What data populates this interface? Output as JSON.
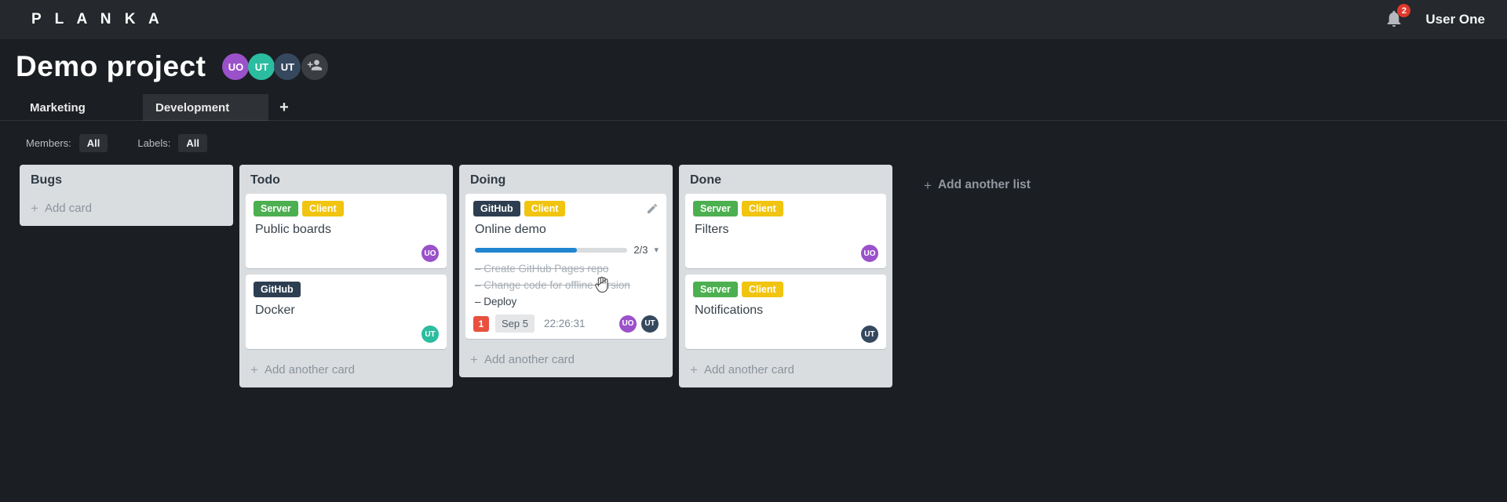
{
  "header": {
    "logo": "P L A N K A",
    "notifications_count": "2",
    "user_name": "User One"
  },
  "project": {
    "title": "Demo project",
    "members": [
      {
        "initials": "UO",
        "color": "#9b51c9"
      },
      {
        "initials": "UT",
        "color": "#2bbd9f"
      },
      {
        "initials": "UT",
        "color": "#35485e"
      }
    ]
  },
  "tabs": {
    "items": [
      {
        "label": "Marketing"
      },
      {
        "label": "Development"
      }
    ],
    "active_index": 1,
    "add_label": "+"
  },
  "filters": {
    "members_label": "Members:",
    "members_value": "All",
    "labels_label": "Labels:",
    "labels_value": "All"
  },
  "board": {
    "add_list_label": "Add another list",
    "lists": [
      {
        "title": "Bugs",
        "footer": "Add card",
        "cards": []
      },
      {
        "title": "Todo",
        "footer": "Add another card",
        "cards": [
          {
            "title": "Public boards",
            "labels": [
              {
                "text": "Server",
                "color": "#4caf50"
              },
              {
                "text": "Client",
                "color": "#f1c40f"
              }
            ],
            "members": [
              {
                "initials": "UO",
                "color": "#9b51c9"
              }
            ]
          },
          {
            "title": "Docker",
            "labels": [
              {
                "text": "GitHub",
                "color": "#2d3e50"
              }
            ],
            "members": [
              {
                "initials": "UT",
                "color": "#2bbd9f"
              }
            ]
          }
        ]
      },
      {
        "title": "Doing",
        "footer": "Add another card",
        "cards": [
          {
            "title": "Online demo",
            "editable": true,
            "labels": [
              {
                "text": "GitHub",
                "color": "#2d3e50"
              },
              {
                "text": "Client",
                "color": "#f1c40f"
              }
            ],
            "progress": {
              "done": 2,
              "total": 3,
              "text": "2/3",
              "color": "#2185d0"
            },
            "tasks": [
              {
                "text": "Create GitHub Pages repo",
                "done": true
              },
              {
                "text": "Change code for offline version",
                "done": true
              },
              {
                "text": "Deploy",
                "done": false
              }
            ],
            "badges": {
              "notifications": "1",
              "notifications_color": "#e9503f",
              "due_date": "Sep 5",
              "timer": "22:26:31"
            },
            "members": [
              {
                "initials": "UO",
                "color": "#9b51c9"
              },
              {
                "initials": "UT",
                "color": "#35485e"
              }
            ]
          }
        ]
      },
      {
        "title": "Done",
        "footer": "Add another card",
        "cards": [
          {
            "title": "Filters",
            "labels": [
              {
                "text": "Server",
                "color": "#4caf50"
              },
              {
                "text": "Client",
                "color": "#f1c40f"
              }
            ],
            "members": [
              {
                "initials": "UO",
                "color": "#9b51c9"
              }
            ]
          },
          {
            "title": "Notifications",
            "labels": [
              {
                "text": "Server",
                "color": "#4caf50"
              },
              {
                "text": "Client",
                "color": "#f1c40f"
              }
            ],
            "members": [
              {
                "initials": "UT",
                "color": "#35485e"
              }
            ]
          }
        ]
      }
    ]
  },
  "task_dash": "– "
}
